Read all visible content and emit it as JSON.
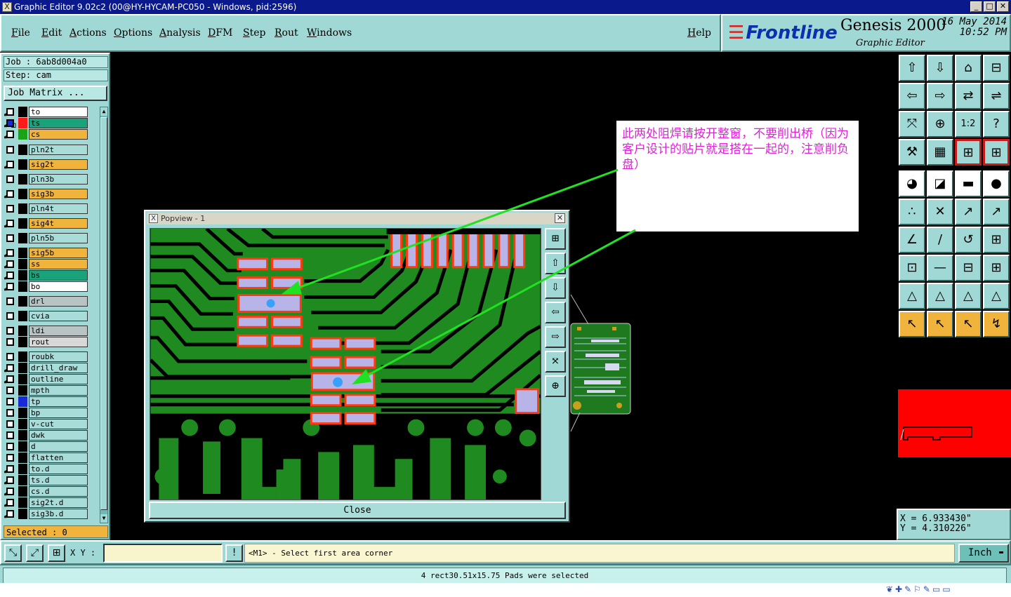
{
  "window": {
    "title": "Graphic Editor 9.02c2 (00@HY-HYCAM-PC050 - Windows, pid:2596)",
    "controls": [
      "_",
      "□",
      "✕"
    ]
  },
  "menu": [
    "File",
    "Edit",
    "Actions",
    "Options",
    "Analysis",
    "DFM",
    "Step",
    "Rout",
    "Windows"
  ],
  "help_label": "Help",
  "brand": {
    "logo": "Frontline",
    "product": "Genesis 2000",
    "subtitle": "Graphic Editor",
    "date": "16 May 2014",
    "time": "10:52 PM"
  },
  "job": {
    "job_line": "Job : 6ab8d004a0",
    "step_line": "Step: cam",
    "matrix_button": "Job Matrix ..."
  },
  "layers": [
    {
      "name": "to",
      "color": "#ffffff",
      "checked": false,
      "swatch": "#000000",
      "flag": "⬋"
    },
    {
      "name": "ts",
      "color": "#1aa27a",
      "checked": true,
      "swatch": "#ff1a1a",
      "flag": "⬋▫"
    },
    {
      "name": "cs",
      "color": "#f0b43c",
      "checked": false,
      "swatch": "#1aa21a",
      "flag": "⬋"
    },
    {
      "name": "pln2t",
      "color": "#a8dcd8",
      "checked": false,
      "swatch": "#000000",
      "flag": ""
    },
    {
      "name": "sig2t",
      "color": "#f0b43c",
      "checked": false,
      "swatch": "#000000",
      "flag": "⬋"
    },
    {
      "name": "pln3b",
      "color": "#a8dcd8",
      "checked": false,
      "swatch": "#000000",
      "flag": ""
    },
    {
      "name": "sig3b",
      "color": "#f0b43c",
      "checked": false,
      "swatch": "#000000",
      "flag": "⬋"
    },
    {
      "name": "pln4t",
      "color": "#a8dcd8",
      "checked": false,
      "swatch": "#000000",
      "flag": ""
    },
    {
      "name": "sig4t",
      "color": "#f0b43c",
      "checked": false,
      "swatch": "#000000",
      "flag": "⬋"
    },
    {
      "name": "pln5b",
      "color": "#a8dcd8",
      "checked": false,
      "swatch": "#000000",
      "flag": ""
    },
    {
      "name": "sig5b",
      "color": "#f0b43c",
      "checked": false,
      "swatch": "#000000",
      "flag": "⬋"
    },
    {
      "name": "ss",
      "color": "#f0b43c",
      "checked": false,
      "swatch": "#000000",
      "flag": "⬋"
    },
    {
      "name": "bs",
      "color": "#1aa27a",
      "checked": false,
      "swatch": "#000000",
      "flag": "⬋"
    },
    {
      "name": "bo",
      "color": "#ffffff",
      "checked": false,
      "swatch": "#000000",
      "flag": "⬋"
    },
    {
      "name": "drl",
      "color": "#b8c4c4",
      "checked": false,
      "swatch": "#000000",
      "flag": ""
    },
    {
      "name": "cvia",
      "color": "#a8dcd8",
      "checked": false,
      "swatch": "#000000",
      "flag": ""
    },
    {
      "name": "ldi",
      "color": "#b8c4c4",
      "checked": false,
      "swatch": "#000000",
      "flag": ""
    },
    {
      "name": "rout",
      "color": "#d8d8d8",
      "checked": false,
      "swatch": "#000000",
      "flag": ""
    },
    {
      "name": "roubk",
      "color": "#a8dcd8",
      "checked": false,
      "swatch": "#000000",
      "flag": ""
    },
    {
      "name": "drill_draw",
      "color": "#a8dcd8",
      "checked": false,
      "swatch": "#000000",
      "flag": "⬋"
    },
    {
      "name": "outline",
      "color": "#a8dcd8",
      "checked": false,
      "swatch": "#000000",
      "flag": "⬋"
    },
    {
      "name": "mpth",
      "color": "#a8dcd8",
      "checked": false,
      "swatch": "#000000",
      "flag": ""
    },
    {
      "name": "tp",
      "color": "#a8dcd8",
      "checked": false,
      "swatch": "#1a2ad8",
      "flag": ""
    },
    {
      "name": "bp",
      "color": "#a8dcd8",
      "checked": false,
      "swatch": "#000000",
      "flag": ""
    },
    {
      "name": "v-cut",
      "color": "#a8dcd8",
      "checked": false,
      "swatch": "#000000",
      "flag": ""
    },
    {
      "name": "dwk",
      "color": "#a8dcd8",
      "checked": false,
      "swatch": "#000000",
      "flag": ""
    },
    {
      "name": "d",
      "color": "#a8dcd8",
      "checked": false,
      "swatch": "#000000",
      "flag": ""
    },
    {
      "name": "flatten",
      "color": "#a8dcd8",
      "checked": false,
      "swatch": "#000000",
      "flag": ""
    },
    {
      "name": "to.d",
      "color": "#a8dcd8",
      "checked": false,
      "swatch": "#000000",
      "flag": "⬋"
    },
    {
      "name": "ts.d",
      "color": "#a8dcd8",
      "checked": false,
      "swatch": "#000000",
      "flag": "⬋"
    },
    {
      "name": "cs.d",
      "color": "#a8dcd8",
      "checked": false,
      "swatch": "#000000",
      "flag": "⬋"
    },
    {
      "name": "sig2t.d",
      "color": "#a8dcd8",
      "checked": false,
      "swatch": "#000000",
      "flag": "⬋"
    },
    {
      "name": "sig3b.d",
      "color": "#a8dcd8",
      "checked": false,
      "swatch": "#000000",
      "flag": "⬋"
    }
  ],
  "selected_text": "Selected : 0",
  "popview": {
    "title": "Popview - 1",
    "close_button": "Close",
    "close_icon": "✕"
  },
  "annotation_text": "此两处阻焊请按开整窗，不要削出桥（因为客户设计的贴片就是搭在一起的，注意削负盘）",
  "coords": {
    "x_line": "X = 6.933430\"",
    "y_line": "Y = 4.310226\""
  },
  "command": {
    "xy_label": "X Y :",
    "xy_value": "",
    "prompt": "<M1> - Select first area corner",
    "units": "Inch",
    "units_arrow": "▬"
  },
  "message": "4 rect30.51x15.75 Pads were selected",
  "tool_glyphs": {
    "row_icons": [
      "⇧",
      "⇩",
      "⌂",
      "⊟",
      "⇦",
      "⇨",
      "⇄",
      "⇌",
      "⤧",
      "⊕",
      "1:2",
      "?",
      "⚒",
      "▦",
      "⊞",
      "⊞",
      "◕",
      "◪",
      "▬",
      "●",
      "∴",
      "✕",
      "↗",
      "↗",
      "∠",
      "/",
      "↺",
      "⊞",
      "⊡",
      "—",
      "⊟",
      "⊞",
      "△",
      "△",
      "△",
      "△",
      "↖",
      "↖",
      "↖",
      "↯"
    ],
    "cmd_icons": [
      "⤡",
      "⤢",
      "⊞",
      "!"
    ]
  },
  "colors": {
    "teal_panel": "#9fd8d4",
    "pcb_green": "#1f8a1f",
    "pad_fill": "#b8b4e8",
    "pad_outline": "#ff3a10",
    "arrow_green": "#22e022",
    "annotation_magenta": "#e020d8"
  }
}
